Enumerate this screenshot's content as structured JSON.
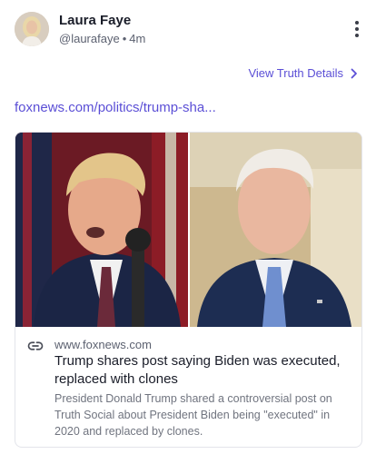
{
  "post": {
    "author_name": "Laura Faye",
    "author_handle": "@laurafaye",
    "separator": "•",
    "time_ago": "4m",
    "details_link_label": "View Truth Details",
    "link_url": "foxnews.com/politics/trump-sha..."
  },
  "link_card": {
    "domain": "www.foxnews.com",
    "title": "Trump shares post saying Biden was executed, replaced with clones",
    "description": "President Donald Trump shared a controversial post on Truth Social about President Biden being \"executed\" in 2020 and replaced by clones."
  },
  "icons": {
    "more": "more-vertical-icon",
    "chevron": "chevron-right-icon",
    "link": "link-icon"
  },
  "colors": {
    "accent": "#5b4fd6",
    "text": "#1a1d29",
    "muted": "#70747f"
  }
}
